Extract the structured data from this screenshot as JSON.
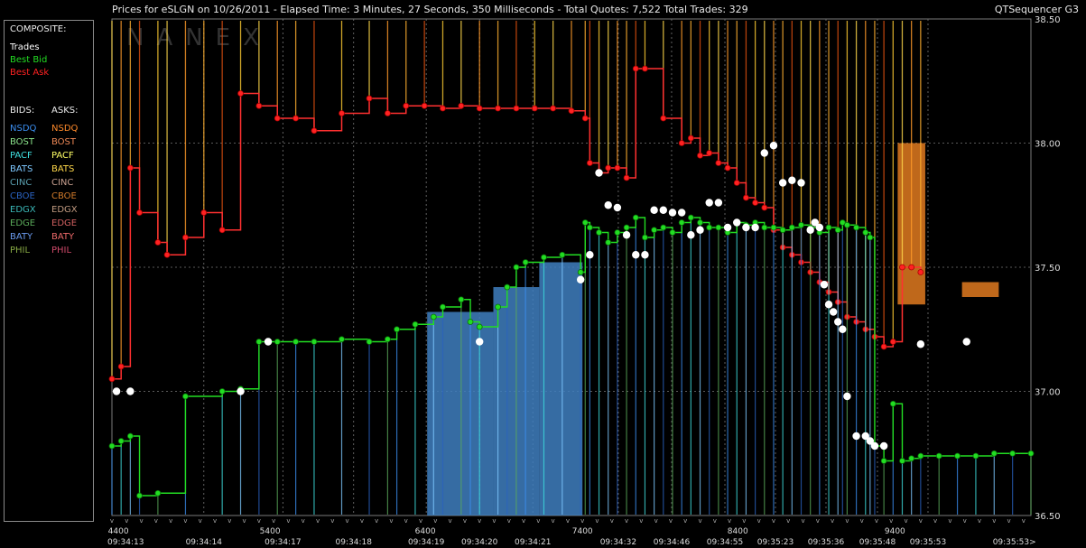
{
  "header": {
    "title": "Prices for  eSLGN  on  10/26/2011  -  Elapsed Time: 3 Minutes, 27 Seconds, 350 Milliseconds  -  Total Quotes: 7,522  Total Trades: 329",
    "app": "QTSequencer G3"
  },
  "watermark": "NANEX",
  "legend": {
    "composite_title": "COMPOSITE:",
    "composite": [
      {
        "label": "Trades",
        "color": "#ffffff"
      },
      {
        "label": "Best Bid",
        "color": "#22dd22"
      },
      {
        "label": "Best Ask",
        "color": "#ff2222"
      }
    ],
    "bids_title": "BIDS:",
    "asks_title": "ASKS:",
    "exchanges": [
      {
        "bid": "NSDQ",
        "ask": "NSDQ",
        "bid_color": "#3b8ef0",
        "ask_color": "#ff8a2a"
      },
      {
        "bid": "BOST",
        "ask": "BOST",
        "bid_color": "#8ce58c",
        "ask_color": "#ee8855"
      },
      {
        "bid": "PACF",
        "ask": "PACF",
        "bid_color": "#3fe0e0",
        "ask_color": "#ffff66"
      },
      {
        "bid": "BATS",
        "ask": "BATS",
        "bid_color": "#7ec8ff",
        "ask_color": "#ffd84a"
      },
      {
        "bid": "CINC",
        "ask": "CINC",
        "bid_color": "#5aa0b0",
        "ask_color": "#c8a090"
      },
      {
        "bid": "CBOE",
        "ask": "CBOE",
        "bid_color": "#2a62c0",
        "ask_color": "#d07a2a"
      },
      {
        "bid": "EDGX",
        "ask": "EDGX",
        "bid_color": "#3ab8b8",
        "ask_color": "#c09a80"
      },
      {
        "bid": "EDGE",
        "ask": "EDGE",
        "bid_color": "#5aaa5a",
        "ask_color": "#d06060"
      },
      {
        "bid": "BATY",
        "ask": "BATY",
        "bid_color": "#6a9aee",
        "ask_color": "#ee6a6a"
      },
      {
        "bid": "PHIL",
        "ask": "PHIL",
        "bid_color": "#88aa44",
        "ask_color": "#d04a6a"
      }
    ]
  },
  "chart_data": {
    "type": "line",
    "title": "Prices for  eSLGN  on  10/26/2011",
    "ylim": [
      36.5,
      38.5
    ],
    "y_ticks": [
      "38.50",
      "38.00",
      "37.50",
      "37.00",
      "36.50"
    ],
    "y_tick_values": [
      38.5,
      38.0,
      37.5,
      37.0,
      36.5
    ],
    "grid": true,
    "volume_labels": [
      {
        "label": "4400",
        "x": 0.7
      },
      {
        "label": "5400",
        "x": 17.2
      },
      {
        "label": "6400",
        "x": 34.1
      },
      {
        "label": "7400",
        "x": 51.2
      },
      {
        "label": "8400",
        "x": 68.1
      },
      {
        "label": "9400",
        "x": 85.2
      }
    ],
    "time_labels": [
      {
        "label": "09:34:13",
        "x": 1.5
      },
      {
        "label": "09:34:14",
        "x": 10.0
      },
      {
        "label": "09:34:17",
        "x": 18.6
      },
      {
        "label": "09:34:18",
        "x": 26.3
      },
      {
        "label": "09:34:19",
        "x": 34.2
      },
      {
        "label": "09:34:20",
        "x": 40.0
      },
      {
        "label": "09:34:21",
        "x": 45.8
      },
      {
        "label": "09:34:32",
        "x": 55.1
      },
      {
        "label": "09:34:46",
        "x": 60.9
      },
      {
        "label": "09:34:55",
        "x": 66.7
      },
      {
        "label": "09:35:23",
        "x": 72.2
      },
      {
        "label": "09:35:36",
        "x": 77.7
      },
      {
        "label": "09:35:48",
        "x": 83.3
      },
      {
        "label": "09:35:53",
        "x": 88.8
      },
      {
        "label": "09:35:53>",
        "x": 98.2
      }
    ],
    "best_bid": {
      "name": "Best Bid",
      "x": [
        0,
        1,
        2,
        3,
        5,
        8,
        12,
        14,
        16,
        18,
        20,
        22,
        25,
        28,
        30,
        31,
        33,
        35,
        36,
        38,
        39,
        40,
        42,
        43,
        44,
        45,
        47,
        49,
        51,
        51.5,
        52,
        53,
        54,
        55,
        56,
        57,
        58,
        59,
        60,
        61,
        62,
        63,
        64,
        65,
        66,
        67,
        68,
        69,
        70,
        71,
        72,
        73,
        74,
        75,
        76,
        77,
        78,
        79,
        79.5,
        80,
        81,
        82,
        82.5,
        83,
        84,
        85,
        86,
        87,
        88,
        90,
        92,
        94,
        96,
        98,
        100
      ],
      "y": [
        36.78,
        36.8,
        36.82,
        36.58,
        36.59,
        36.98,
        37.0,
        37.01,
        37.2,
        37.2,
        37.2,
        37.2,
        37.21,
        37.2,
        37.21,
        37.25,
        37.27,
        37.3,
        37.34,
        37.37,
        37.28,
        37.26,
        37.34,
        37.42,
        37.5,
        37.52,
        37.54,
        37.55,
        37.48,
        37.68,
        37.66,
        37.64,
        37.6,
        37.64,
        37.66,
        37.7,
        37.62,
        37.65,
        37.66,
        37.64,
        37.68,
        37.7,
        37.68,
        37.66,
        37.66,
        37.64,
        37.68,
        37.67,
        37.68,
        37.66,
        37.66,
        37.65,
        37.66,
        37.67,
        37.66,
        37.64,
        37.66,
        37.65,
        37.68,
        37.67,
        37.66,
        37.64,
        37.62,
        36.78,
        36.72,
        36.95,
        36.72,
        36.73,
        36.74,
        36.74,
        36.74,
        36.74,
        36.75,
        36.75,
        36.75
      ]
    },
    "best_ask": {
      "name": "Best Ask",
      "x": [
        0,
        1,
        2,
        3,
        5,
        6,
        8,
        10,
        12,
        14,
        16,
        18,
        20,
        22,
        25,
        28,
        30,
        32,
        34,
        36,
        38,
        40,
        42,
        44,
        46,
        48,
        50,
        51.5,
        52,
        53,
        54,
        55,
        56,
        57,
        58,
        60,
        62,
        63,
        64,
        65,
        66,
        67,
        68,
        69,
        70,
        71,
        72,
        73,
        74,
        75,
        76,
        77,
        78,
        79,
        80,
        81,
        82,
        83,
        84,
        85,
        86,
        87,
        88
      ],
      "y": [
        37.05,
        37.1,
        37.9,
        37.72,
        37.6,
        37.55,
        37.62,
        37.72,
        37.65,
        38.2,
        38.15,
        38.1,
        38.1,
        38.05,
        38.12,
        38.18,
        38.12,
        38.15,
        38.15,
        38.14,
        38.15,
        38.14,
        38.14,
        38.14,
        38.14,
        38.14,
        38.13,
        38.1,
        37.92,
        37.88,
        37.9,
        37.9,
        37.86,
        38.3,
        38.3,
        38.1,
        38.0,
        38.02,
        37.95,
        37.96,
        37.92,
        37.9,
        37.84,
        37.78,
        37.76,
        37.74,
        37.65,
        37.58,
        37.55,
        37.52,
        37.48,
        37.44,
        37.4,
        37.36,
        37.3,
        37.28,
        37.25,
        37.22,
        37.18,
        37.2,
        37.5,
        37.5,
        37.48
      ]
    },
    "trades": {
      "name": "Trades",
      "x": [
        0.5,
        2,
        14,
        17,
        40,
        51,
        52,
        53,
        54,
        55,
        56,
        57,
        58,
        59,
        60,
        61,
        62,
        63,
        64,
        65,
        66,
        67,
        68,
        69,
        70,
        71,
        72,
        73,
        74,
        75,
        76,
        76.5,
        77,
        77.5,
        78,
        78.5,
        79,
        79.5,
        80,
        81,
        82,
        82.5,
        83,
        84,
        88,
        93
      ],
      "y": [
        37.0,
        37.0,
        37.0,
        37.2,
        37.2,
        37.45,
        37.55,
        37.88,
        37.75,
        37.74,
        37.63,
        37.55,
        37.55,
        37.73,
        37.73,
        37.72,
        37.72,
        37.63,
        37.65,
        37.76,
        37.76,
        37.66,
        37.68,
        37.66,
        37.66,
        37.96,
        37.99,
        37.84,
        37.85,
        37.84,
        37.65,
        37.68,
        37.66,
        37.43,
        37.35,
        37.32,
        37.28,
        37.25,
        36.98,
        36.82,
        36.82,
        36.8,
        36.78,
        36.78,
        37.19,
        37.2
      ]
    },
    "bid_fill_regions": [
      {
        "name": "NSDQ",
        "x0": 34.3,
        "x1": 41.5,
        "y": 37.32
      },
      {
        "name": "NSDQ",
        "x0": 41.5,
        "x1": 46.5,
        "y": 37.42
      },
      {
        "name": "NSDQ",
        "x0": 46.5,
        "x1": 51.2,
        "y": 37.52
      }
    ],
    "ask_fill_regions": [
      {
        "name": "NSDQ",
        "x0": 85.5,
        "x1": 88.5,
        "y": 38.0,
        "y2": 37.35
      },
      {
        "name": "NSDQ",
        "x0": 92.5,
        "x1": 96.5,
        "y": 37.44,
        "y2": 37.38
      }
    ]
  }
}
